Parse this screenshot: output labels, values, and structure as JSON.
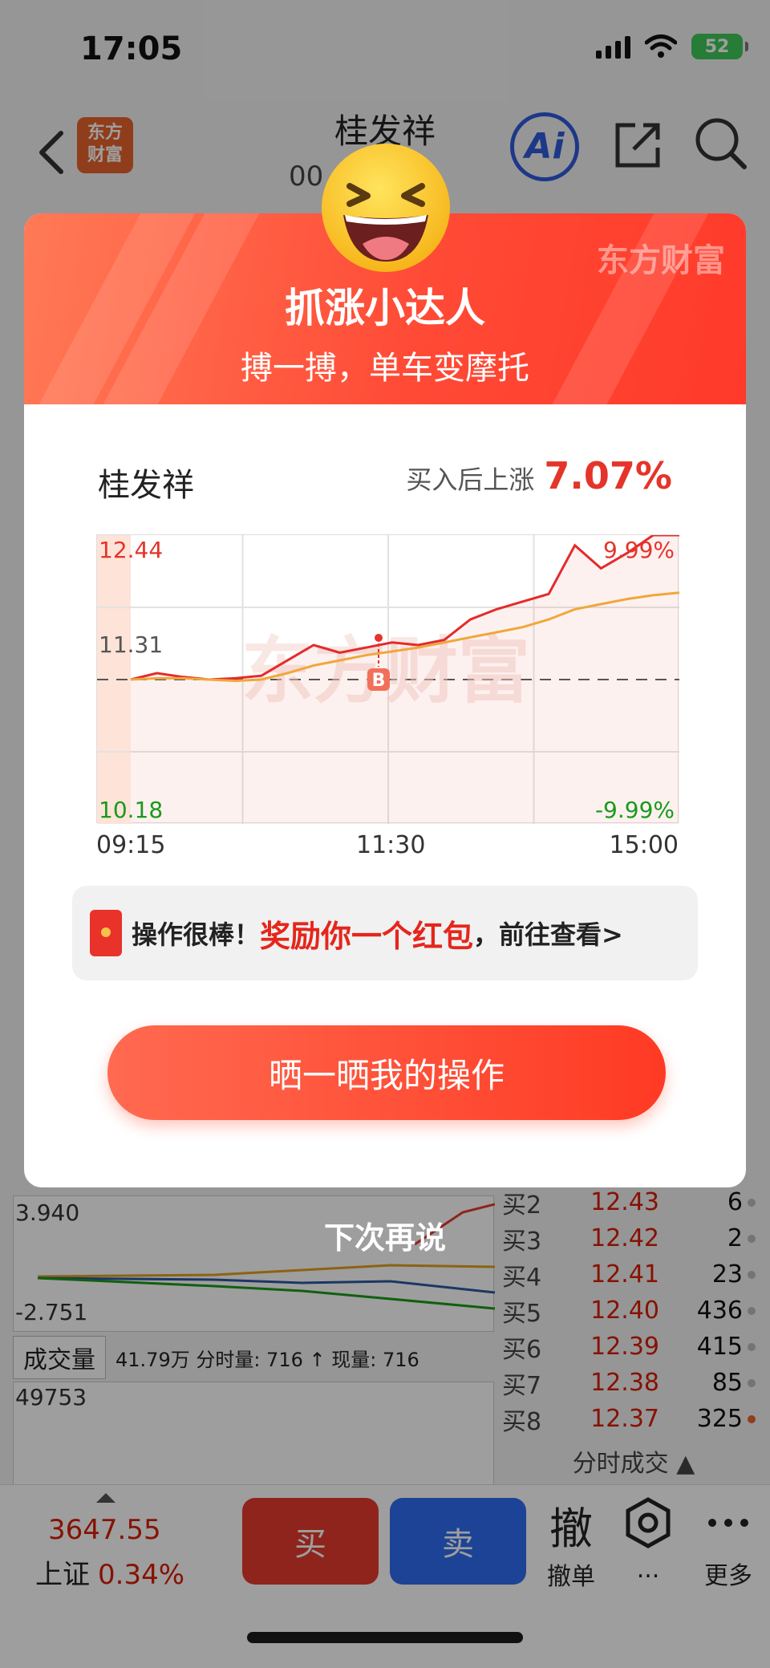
{
  "status_bar": {
    "time": "17:05",
    "battery": "52"
  },
  "header": {
    "title": "桂发祥",
    "code": "00",
    "brand_logo": "东方\n财富",
    "ai_label": "Ai"
  },
  "background": {
    "mini_chart_top": "3.940",
    "mini_chart_bottom": "-2.751",
    "volume_select": "成交量",
    "volume_info": "41.79万 分时量: 716 ↑ 现量: 716",
    "volume_top": "49753"
  },
  "orderbook": {
    "rows": [
      {
        "label": "买2",
        "price": "12.43",
        "vol": "6"
      },
      {
        "label": "买3",
        "price": "12.42",
        "vol": "2"
      },
      {
        "label": "买4",
        "price": "12.41",
        "vol": "23"
      },
      {
        "label": "买5",
        "price": "12.40",
        "vol": "436"
      },
      {
        "label": "买6",
        "price": "12.39",
        "vol": "415"
      },
      {
        "label": "买7",
        "price": "12.38",
        "vol": "85"
      },
      {
        "label": "买8",
        "price": "12.37",
        "vol": "325"
      }
    ],
    "footer": "分时成交 ▲"
  },
  "bottom_bar": {
    "index_value": "3647.55",
    "index_name": "上证",
    "index_pct": "0.34%",
    "buy": "买",
    "sell": "卖",
    "cancel_big": "撤",
    "cancel_small": "撤单",
    "gear_label": "...",
    "more_label": "更多"
  },
  "modal": {
    "watermark": "东方财富",
    "title": "抓涨小达人",
    "subtitle": "搏一搏，单车变摩托",
    "stock_name": "桂发祥",
    "gain_label": "买入后上涨",
    "gain_value": "7.07%",
    "chart_watermark": "东方财富",
    "notice_a": "操作很棒！",
    "notice_b": "奖励你一个红包",
    "notice_c": "，前往查看>",
    "share_button": "晒一晒我的操作",
    "later": "下次再说"
  },
  "chart_data": {
    "type": "line",
    "y_high": "12.44",
    "y_mid": "11.31",
    "y_low": "10.18",
    "pct_high": "9.99%",
    "pct_low": "-9.99%",
    "x_ticks": [
      "09:15",
      "11:30",
      "15:00"
    ],
    "ylim": [
      10.18,
      12.44
    ],
    "buy_marker": "B",
    "series": [
      {
        "color": "#e32b2b",
        "values": [
          11.31,
          11.36,
          11.33,
          11.31,
          11.32,
          11.34,
          11.46,
          11.58,
          11.52,
          11.56,
          11.6,
          11.58,
          11.62,
          11.78,
          11.86,
          11.92,
          11.98,
          12.36,
          12.18,
          12.3,
          12.44,
          12.44
        ]
      },
      {
        "color": "#f0a73a",
        "values": [
          11.31,
          11.32,
          11.32,
          11.31,
          11.3,
          11.31,
          11.36,
          11.42,
          11.46,
          11.5,
          11.53,
          11.56,
          11.6,
          11.64,
          11.68,
          11.72,
          11.78,
          11.86,
          11.9,
          11.94,
          11.97,
          11.99
        ]
      }
    ]
  },
  "colors": {
    "up": "#e5342a",
    "down": "#1a9a1a",
    "accent": "#ff4a36"
  }
}
